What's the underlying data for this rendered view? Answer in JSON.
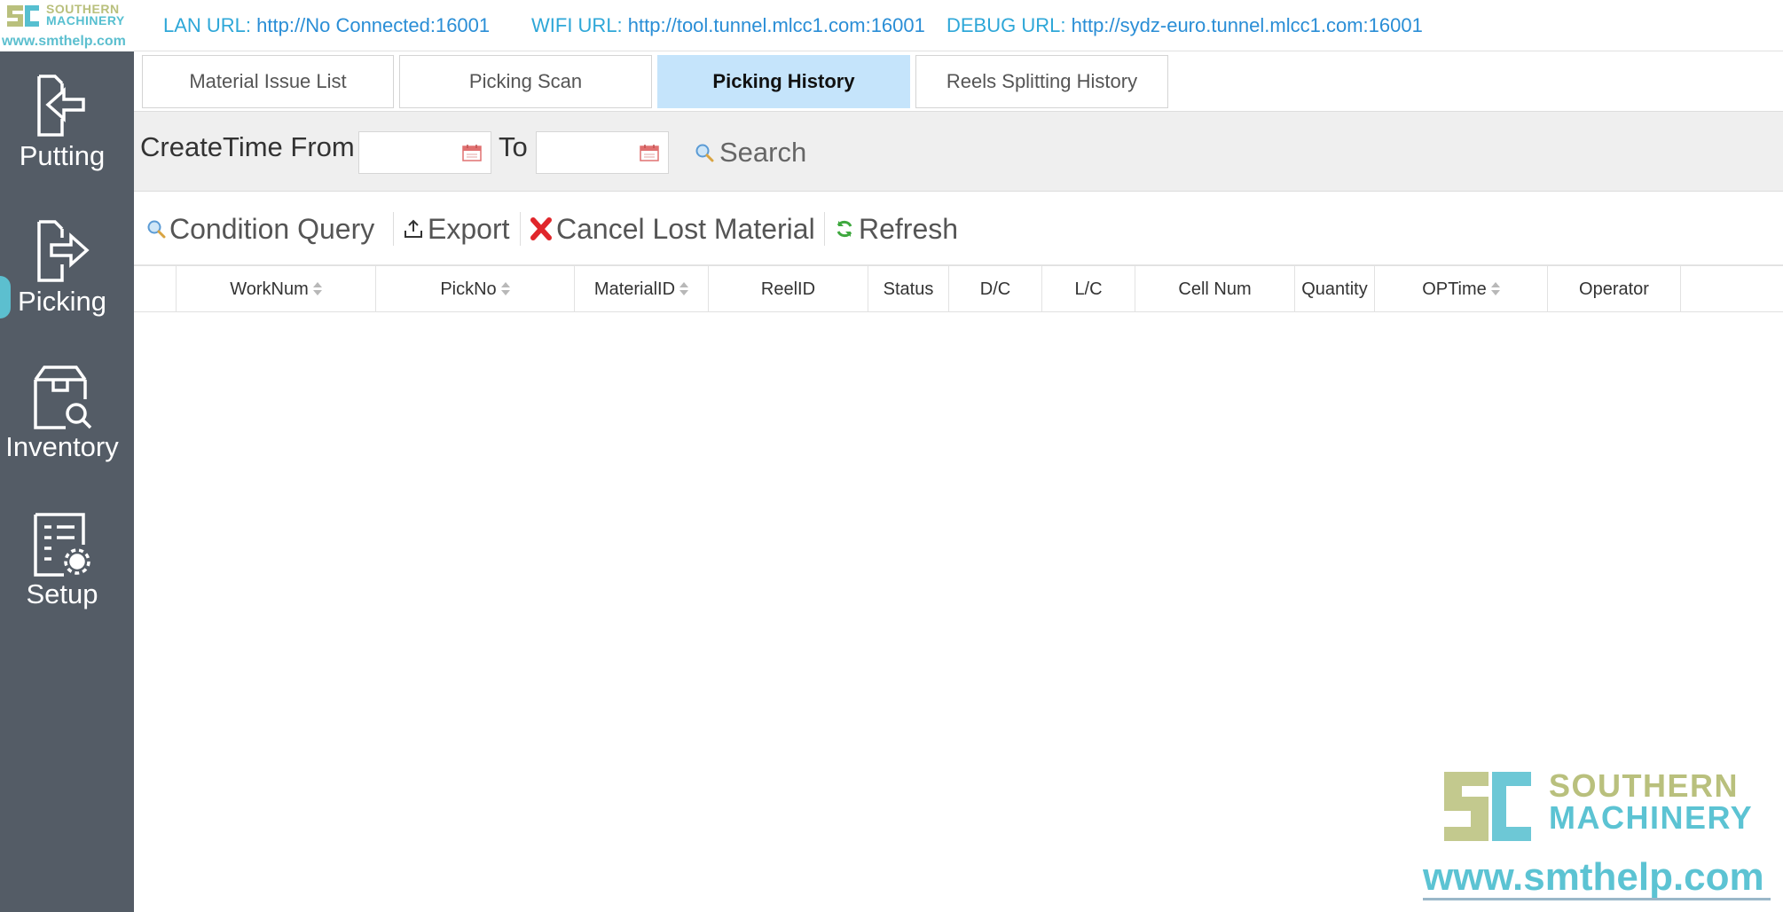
{
  "brand": {
    "logo_line1": "SOUTHERN",
    "logo_line2": "MACHINERY",
    "website": "www.smthelp.com",
    "colors": {
      "olive": "#b9c07d",
      "cyan": "#5cc3d3"
    }
  },
  "sidebar": {
    "items": [
      {
        "label": "Putting",
        "icon": "putting-icon",
        "active": false
      },
      {
        "label": "Picking",
        "icon": "picking-icon",
        "active": true
      },
      {
        "label": "Inventory",
        "icon": "inventory-icon",
        "active": false
      },
      {
        "label": "Setup",
        "icon": "setup-icon",
        "active": false
      }
    ],
    "background": "#545c66"
  },
  "urlbar": {
    "lan_label": "LAN URL:",
    "lan_value": "http://No Connected:16001",
    "wifi_label": "WIFI URL:",
    "wifi_value": "http://tool.tunnel.mlcc1.com:16001",
    "debug_label": "DEBUG URL:",
    "debug_value": "http://sydz-euro.tunnel.mlcc1.com:16001"
  },
  "tabs": [
    {
      "label": "Material Issue List",
      "active": false
    },
    {
      "label": "Picking Scan",
      "active": false
    },
    {
      "label": "Picking History",
      "active": true
    },
    {
      "label": "Reels Splitting History",
      "active": false
    }
  ],
  "search": {
    "from_label": "CreateTime From",
    "to_label": "To",
    "from_value": "",
    "to_value": "",
    "search_label": "Search"
  },
  "toolbar": {
    "condition_query": "Condition Query",
    "export": "Export",
    "cancel_lost_material": "Cancel Lost Material",
    "refresh": "Refresh"
  },
  "table": {
    "columns": [
      {
        "label": "WorkNum",
        "sortable": true
      },
      {
        "label": "PickNo",
        "sortable": true
      },
      {
        "label": "MaterialID",
        "sortable": true
      },
      {
        "label": "ReelID",
        "sortable": false
      },
      {
        "label": "Status",
        "sortable": false
      },
      {
        "label": "D/C",
        "sortable": false
      },
      {
        "label": "L/C",
        "sortable": false
      },
      {
        "label": "Cell Num",
        "sortable": false
      },
      {
        "label": "Quantity",
        "sortable": false
      },
      {
        "label": "OPTime",
        "sortable": true
      },
      {
        "label": "Operator",
        "sortable": false
      }
    ],
    "rows": []
  }
}
